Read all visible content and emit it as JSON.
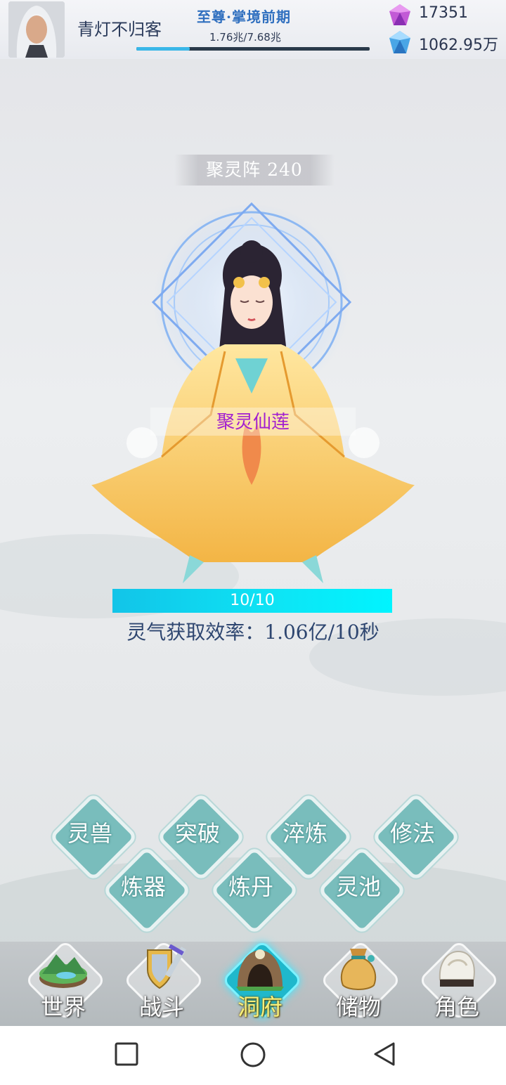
{
  "player": {
    "name": "青灯不归客",
    "realm": "至尊·掌境前期",
    "exp_text": "1.76兆/7.68兆",
    "exp_progress": 0.23
  },
  "currency": {
    "gems": "17351",
    "crystals": "1062.95万"
  },
  "formation": {
    "title": "聚灵阵 240",
    "lotus_name": "聚灵仙莲",
    "progress_text": "10/10",
    "progress": 1.0,
    "rate_text": "灵气获取效率：1.06亿/10秒"
  },
  "actions": [
    {
      "label": "灵兽"
    },
    {
      "label": "突破"
    },
    {
      "label": "淬炼"
    },
    {
      "label": "修法"
    },
    {
      "label": "炼器"
    },
    {
      "label": "炼丹"
    },
    {
      "label": "灵池"
    }
  ],
  "nav": [
    {
      "label": "世界",
      "icon": "world-island-icon",
      "active": false
    },
    {
      "label": "战斗",
      "icon": "sword-shield-icon",
      "active": false
    },
    {
      "label": "洞府",
      "icon": "cave-icon",
      "active": true
    },
    {
      "label": "储物",
      "icon": "bag-icon",
      "active": false
    },
    {
      "label": "角色",
      "icon": "helmet-icon",
      "active": false
    }
  ],
  "colors": {
    "accent": "#79bdbc",
    "progress": "#0de5f5",
    "realm_text": "#2f6fbf",
    "lotus_text": "#a21fd0",
    "active_nav_label": "#f8f07a"
  }
}
